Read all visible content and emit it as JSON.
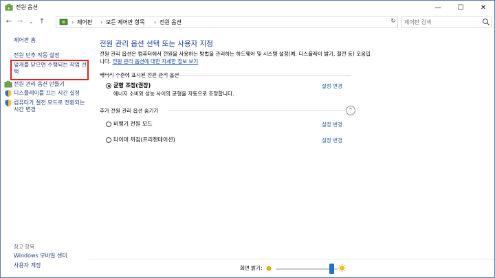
{
  "window": {
    "title": "전원 옵션"
  },
  "controls": {
    "minimize": "—",
    "maximize": "☐",
    "close": "✕"
  },
  "nav": {
    "back": "←",
    "forward": "→",
    "recent": "⌄",
    "up": "↑",
    "breadcrumb": [
      "제어판",
      "모든 제어판 항목",
      "전원 옵션"
    ],
    "separator": "›",
    "refresh": "↻",
    "search_placeholder": "제어판 검색"
  },
  "sidebar": {
    "home": "제어판 홈",
    "items": [
      "전원 단추 작동 설정",
      "덮개를 닫으면 수행되는 작업 선택",
      "전원 관리 옵션 만들기",
      "디스플레이를 끄는 시간 설정",
      "컴퓨터가 절전 모드로 전환되는 시간 변경"
    ],
    "see_also_heading": "참고 항목",
    "see_also": [
      "Windows 모바일 센터",
      "사용자 계정"
    ]
  },
  "main": {
    "title": "전원 관리 옵션 선택 또는 사용자 지정",
    "description": "전원 관리 옵션은 컴퓨터에서 전원을 사용하는 방법을 관리하는 하드웨어 및 시스템 설정(예: 디스플레이 밝기, 절전 등) 모음입니다.",
    "description_link": "전원 관리 옵션에 대한 자세한 정보 보기",
    "battery_section": "배터리 수준에 표시된 전원 관리 옵션",
    "balanced": {
      "name": "균형 조정(권장)",
      "desc": "에너지 소비와 성능 사이의 균형을 자동으로 조정합니다.",
      "change": "설정 변경"
    },
    "hidden_section": "추가 전원 관리 옵션 숨기기",
    "collapse_glyph": "⌃",
    "plans": [
      {
        "name": "비행기 전원 모드",
        "change": "설정 변경"
      },
      {
        "name": "타이머 꺼짐(프리젠테이션)",
        "change": "설정 변경"
      }
    ]
  },
  "footer": {
    "brightness_label": "화면 밝기:",
    "brightness_level": 0.9
  }
}
